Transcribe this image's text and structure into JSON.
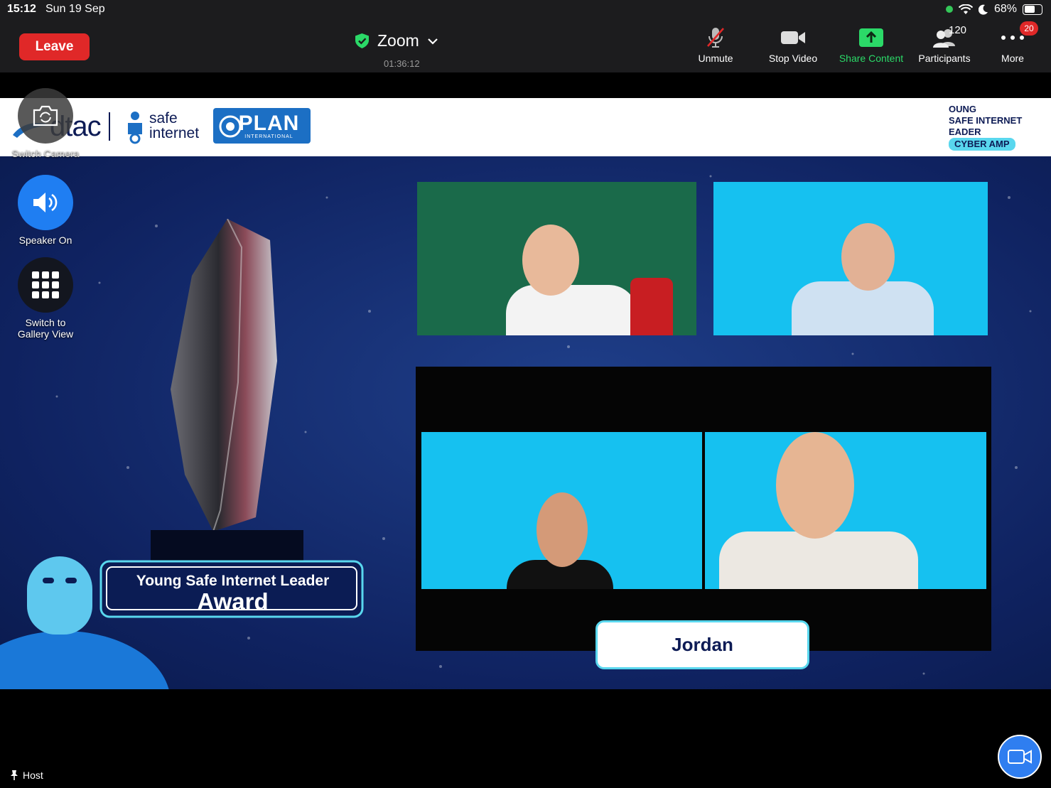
{
  "status_bar": {
    "time": "15:12",
    "date": "Sun 19 Sep",
    "battery": "68%",
    "battery_level": 0.68
  },
  "toolbar": {
    "leave_label": "Leave",
    "meeting_title": "Zoom",
    "timer": "01:36:12",
    "unmute_label": "Unmute",
    "stop_video_label": "Stop Video",
    "share_label": "Share Content",
    "participants_label": "Participants",
    "participants_count": "120",
    "more_label": "More",
    "more_badge": "20"
  },
  "left_controls": {
    "switch_camera_label": "Switch Camera",
    "speaker_label": "Speaker On",
    "gallery_label_1": "Switch to",
    "gallery_label_2": "Gallery View"
  },
  "banner": {
    "dtac": "dtac",
    "safe_line1": "safe",
    "safe_line2": "internet",
    "plan_big": "PLAN",
    "plan_small": "INTERNATIONAL",
    "camp_line1": "OUNG",
    "camp_line2": "SAFE INTERNET",
    "camp_line3": "EADER",
    "camp_line4": "CYBER AMP"
  },
  "award": {
    "line1": "Young Safe Internet Leader",
    "line2": "Award"
  },
  "name_card": "Jordan",
  "footer": {
    "host_label": "Host"
  },
  "colors": {
    "leave_red": "#e02828",
    "share_green": "#2bd968",
    "accent_blue": "#2f7ef0",
    "stage_blue": "#0f2260"
  }
}
